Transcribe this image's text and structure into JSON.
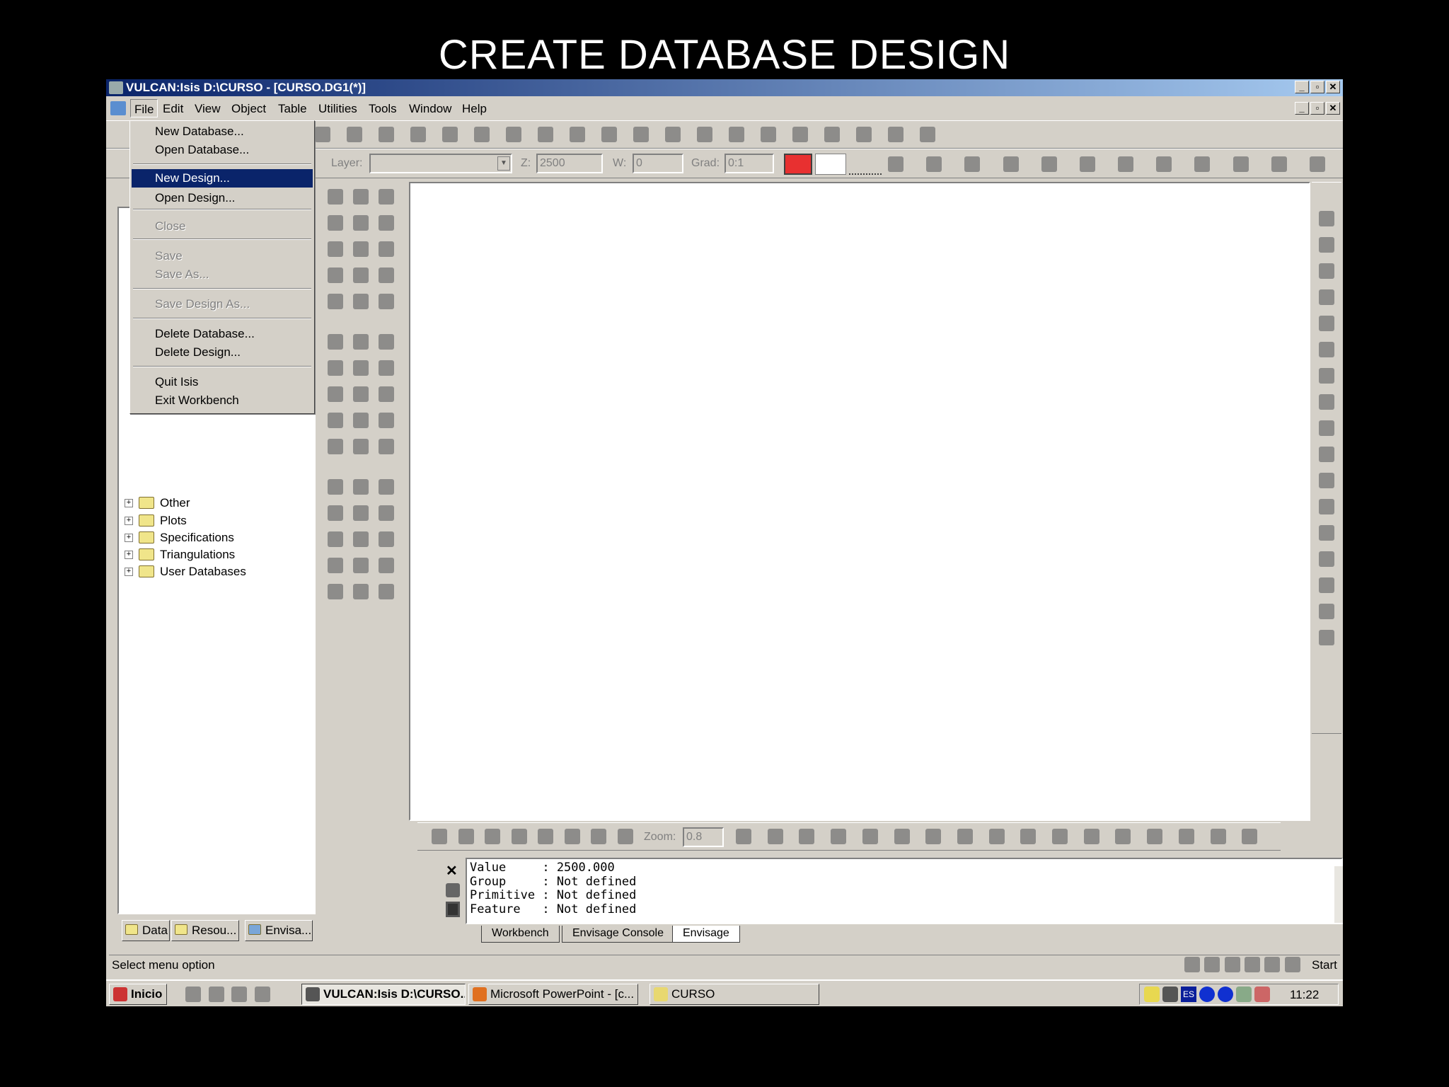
{
  "slide_title": "CREATE DATABASE DESIGN",
  "window": {
    "title": "VULCAN:Isis  D:\\CURSO - [CURSO.DG1(*)]",
    "caption_buttons": [
      "_",
      "▫",
      "✕"
    ]
  },
  "menubar": [
    "File",
    "Edit",
    "View",
    "Object",
    "Table",
    "Utilities",
    "Tools",
    "Window",
    "Help"
  ],
  "file_menu": {
    "items": [
      {
        "label": "New Database...",
        "state": "normal"
      },
      {
        "label": "Open Database...",
        "state": "normal"
      },
      {
        "label": "New Design...",
        "state": "highlighted"
      },
      {
        "label": "Open Design...",
        "state": "normal"
      },
      {
        "label": "Close",
        "state": "disabled"
      },
      {
        "label": "Save",
        "state": "disabled"
      },
      {
        "label": "Save As...",
        "state": "disabled"
      },
      {
        "label": "Save Design As...",
        "state": "disabled"
      },
      {
        "label": "Delete Database...",
        "state": "normal"
      },
      {
        "label": "Delete Design...",
        "state": "normal"
      },
      {
        "label": "Quit Isis",
        "state": "normal"
      },
      {
        "label": "Exit Workbench",
        "state": "normal"
      }
    ]
  },
  "attributes_toolbar": {
    "layer_label": "Layer:",
    "layer_value": "",
    "z_label": "Z:",
    "z_value": "2500",
    "w_label": "W:",
    "w_value": "0",
    "grad_label": "Grad:",
    "grad_value": "0:1",
    "colour": "#e83030"
  },
  "tree": [
    "Other",
    "Plots",
    "Specifications",
    "Triangulations",
    "User Databases"
  ],
  "left_tabs": [
    "Data",
    "Resou...",
    "Envisa..."
  ],
  "bottom_toolbar": {
    "zoom_label": "Zoom:",
    "zoom_value": "0.8"
  },
  "console": {
    "lines": [
      "Value     : 2500.000",
      "Group     : Not defined",
      "Primitive : Not defined",
      "Feature   : Not defined"
    ]
  },
  "console_tabs": [
    "Workbench",
    "Envisage Console",
    "Envisage"
  ],
  "status": {
    "text": "Select menu option",
    "start_label": "Start"
  },
  "taskbar": {
    "start": "Inicio",
    "tasks": [
      "VULCAN:Isis  D:\\CURSO...",
      "Microsoft PowerPoint - [c...",
      "CURSO"
    ],
    "tray_lang": "ES",
    "clock": "11:22"
  }
}
